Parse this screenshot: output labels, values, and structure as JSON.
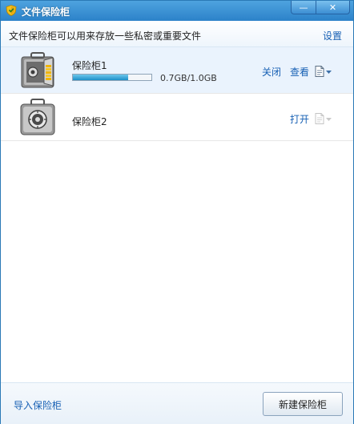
{
  "window": {
    "title": "文件保险柜",
    "minimize_glyph": "—",
    "close_glyph": "✕"
  },
  "header": {
    "description": "文件保险柜可以用来存放一些私密或重要文件",
    "settings_label": "设置"
  },
  "safes": [
    {
      "name": "保险柜1",
      "state": "open",
      "usage_fraction": 0.7,
      "usage_text": "0.7GB/1.0GB",
      "close_label": "关闭",
      "view_label": "查看"
    },
    {
      "name": "保险柜2",
      "state": "locked",
      "open_label": "打开"
    }
  ],
  "footer": {
    "import_label": "导入保险柜",
    "new_label": "新建保险柜"
  },
  "colors": {
    "title_bar": "#2c82c9",
    "link": "#1760b4",
    "selected_row": "#eaf3fd",
    "usage_fill": "#1c8fc8"
  },
  "icons": {
    "app": "shield-icon",
    "safe_open": "open-safe-icon",
    "safe_locked": "locked-safe-icon",
    "doc_menu": "document-dropdown-icon"
  }
}
